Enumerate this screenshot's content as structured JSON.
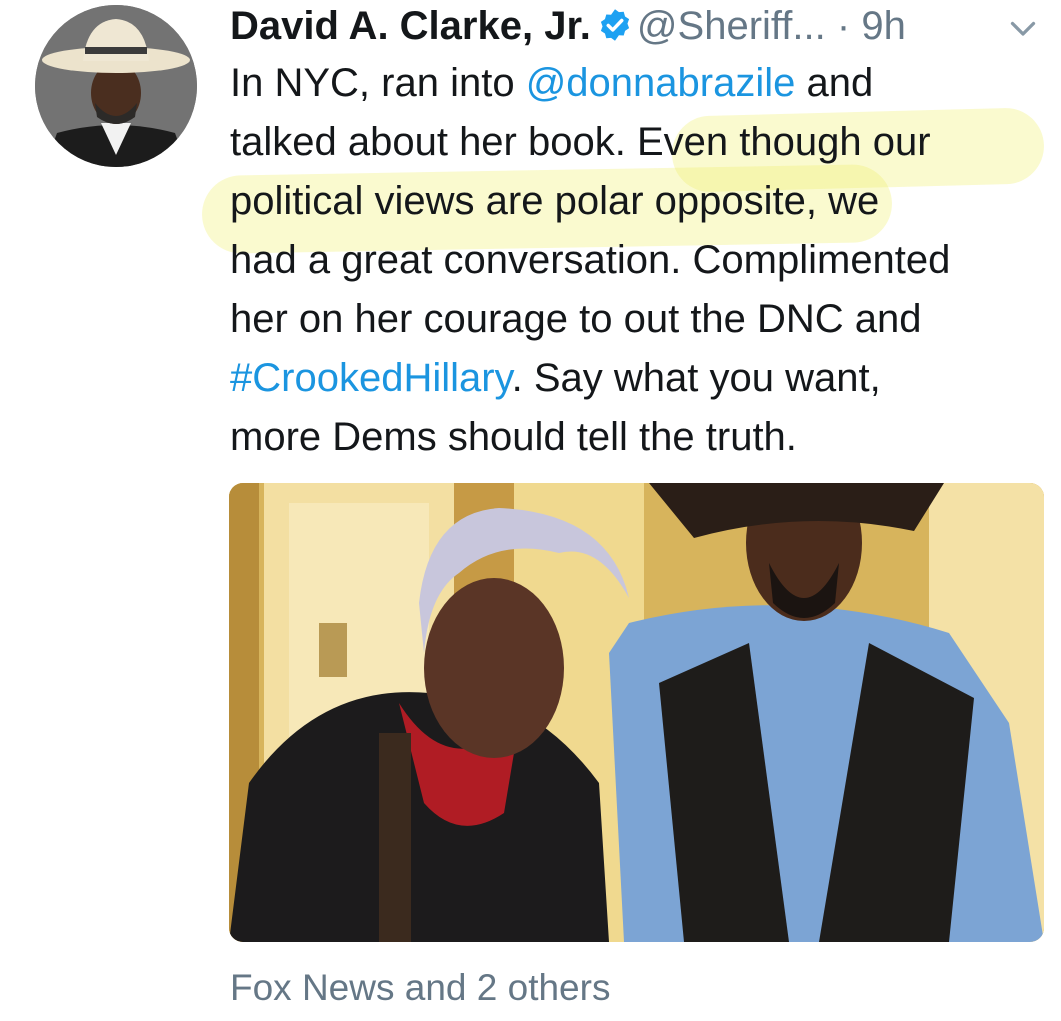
{
  "tweet": {
    "author_name": "David A. Clarke, Jr.",
    "handle": "@Sheriff...",
    "separator": "·",
    "time": "9h",
    "text": {
      "l1_a": "In NYC, ran into ",
      "l1_mention": "@donnabrazile",
      "l1_b": " and",
      "l2": "talked about her book. Even though our",
      "l3": "political views are polar opposite, we",
      "l4": "had a great conversation. Complimented",
      "l5": "her on her courage to out the DNC and",
      "l6_hashtag": "#CrookedHillary",
      "l6_b": ". Say what you want,",
      "l7": "more Dems should tell the truth."
    },
    "footer": "Fox News and 2 others"
  },
  "icons": {
    "verified": "verified-badge-icon",
    "menu": "chevron-down-icon"
  },
  "colors": {
    "link": "#1b95e0",
    "secondary": "#657786",
    "verified": "#1da1f2",
    "highlight": "#f0f06e"
  }
}
